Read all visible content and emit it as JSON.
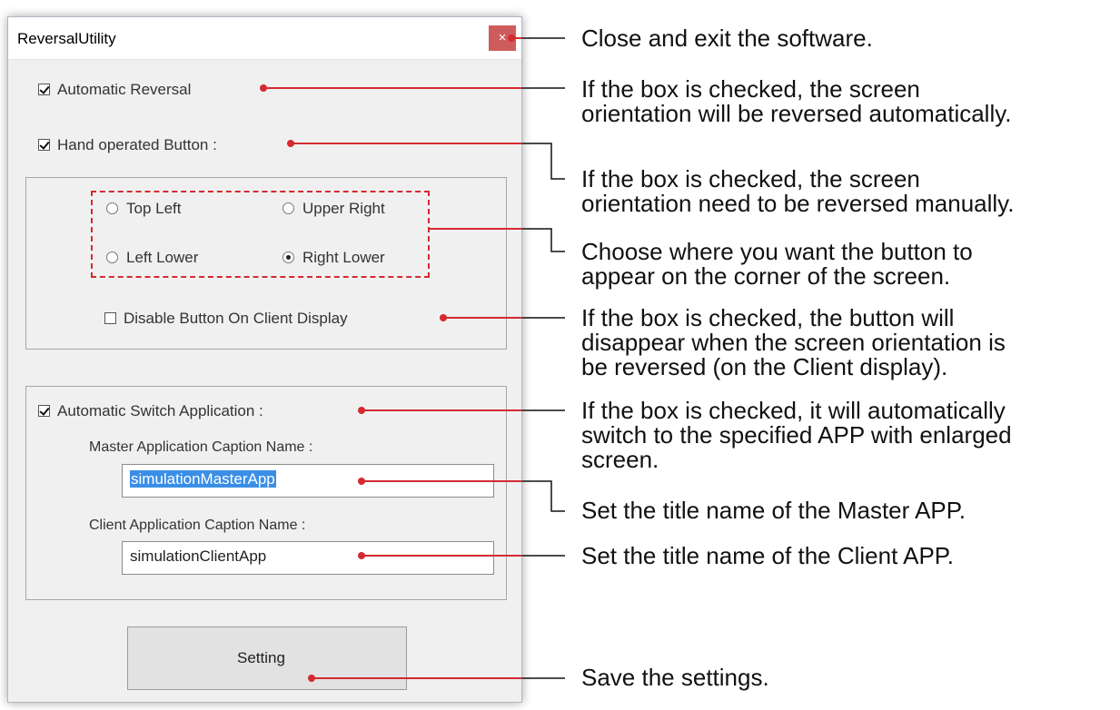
{
  "window": {
    "title": "ReversalUtility",
    "close_glyph": "×"
  },
  "controls": {
    "automatic_reversal": {
      "label": "Automatic Reversal",
      "checked": true
    },
    "hand_operated_button": {
      "label": "Hand operated Button :",
      "checked": true
    },
    "positions": {
      "top_left": {
        "label": "Top Left",
        "selected": false
      },
      "upper_right": {
        "label": "Upper Right",
        "selected": false
      },
      "left_lower": {
        "label": "Left Lower",
        "selected": false
      },
      "right_lower": {
        "label": "Right Lower",
        "selected": true
      }
    },
    "disable_button_on_client": {
      "label": "Disable Button On Client Display",
      "checked": false
    },
    "automatic_switch_application": {
      "label": "Automatic Switch  Application :",
      "checked": true
    },
    "master_caption": {
      "label": "Master  Application Caption Name :",
      "value": "simulationMasterApp"
    },
    "client_caption": {
      "label": "Client  Application Caption Name :",
      "value": "simulationClientApp"
    },
    "setting_button": "Setting"
  },
  "annotations": {
    "close": "Close and exit the software.",
    "automatic_reversal": "If the box is checked, the screen\norientation will be reversed automatically.",
    "hand_operated": "If the box is checked, the screen\norientation need to be reversed manually.",
    "corner_choice": "Choose where you want the button to\nappear on the corner of the screen.",
    "disable_button": "If the box is checked, the button will\ndisappear when the screen orientation is\nbe reversed (on the Client display).",
    "auto_switch": "If the box is checked, it will automatically\nswitch to the specified APP with enlarged\nscreen.",
    "master_caption": "Set the title name of the Master APP.",
    "client_caption": "Set the title name of the Client APP.",
    "save": "Save the settings."
  },
  "colors": {
    "accent_red": "#d42a30",
    "close_button": "#cf5c5c",
    "selection_blue": "#3a8ee6"
  }
}
